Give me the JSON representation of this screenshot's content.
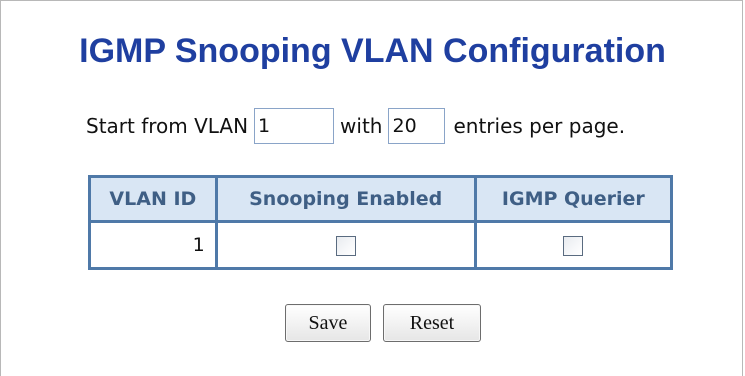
{
  "page": {
    "title": "IGMP Snooping VLAN Configuration"
  },
  "paging": {
    "start_label": "Start from VLAN",
    "start_value": "1",
    "with_label": "with",
    "entries_value": "20",
    "entries_label": "entries per page."
  },
  "table": {
    "headers": [
      "VLAN ID",
      "Snooping Enabled",
      "IGMP Querier"
    ],
    "rows": [
      {
        "vlan_id": "1",
        "snooping_enabled": false,
        "igmp_querier": false
      }
    ]
  },
  "buttons": {
    "save_label": "Save",
    "reset_label": "Reset"
  }
}
